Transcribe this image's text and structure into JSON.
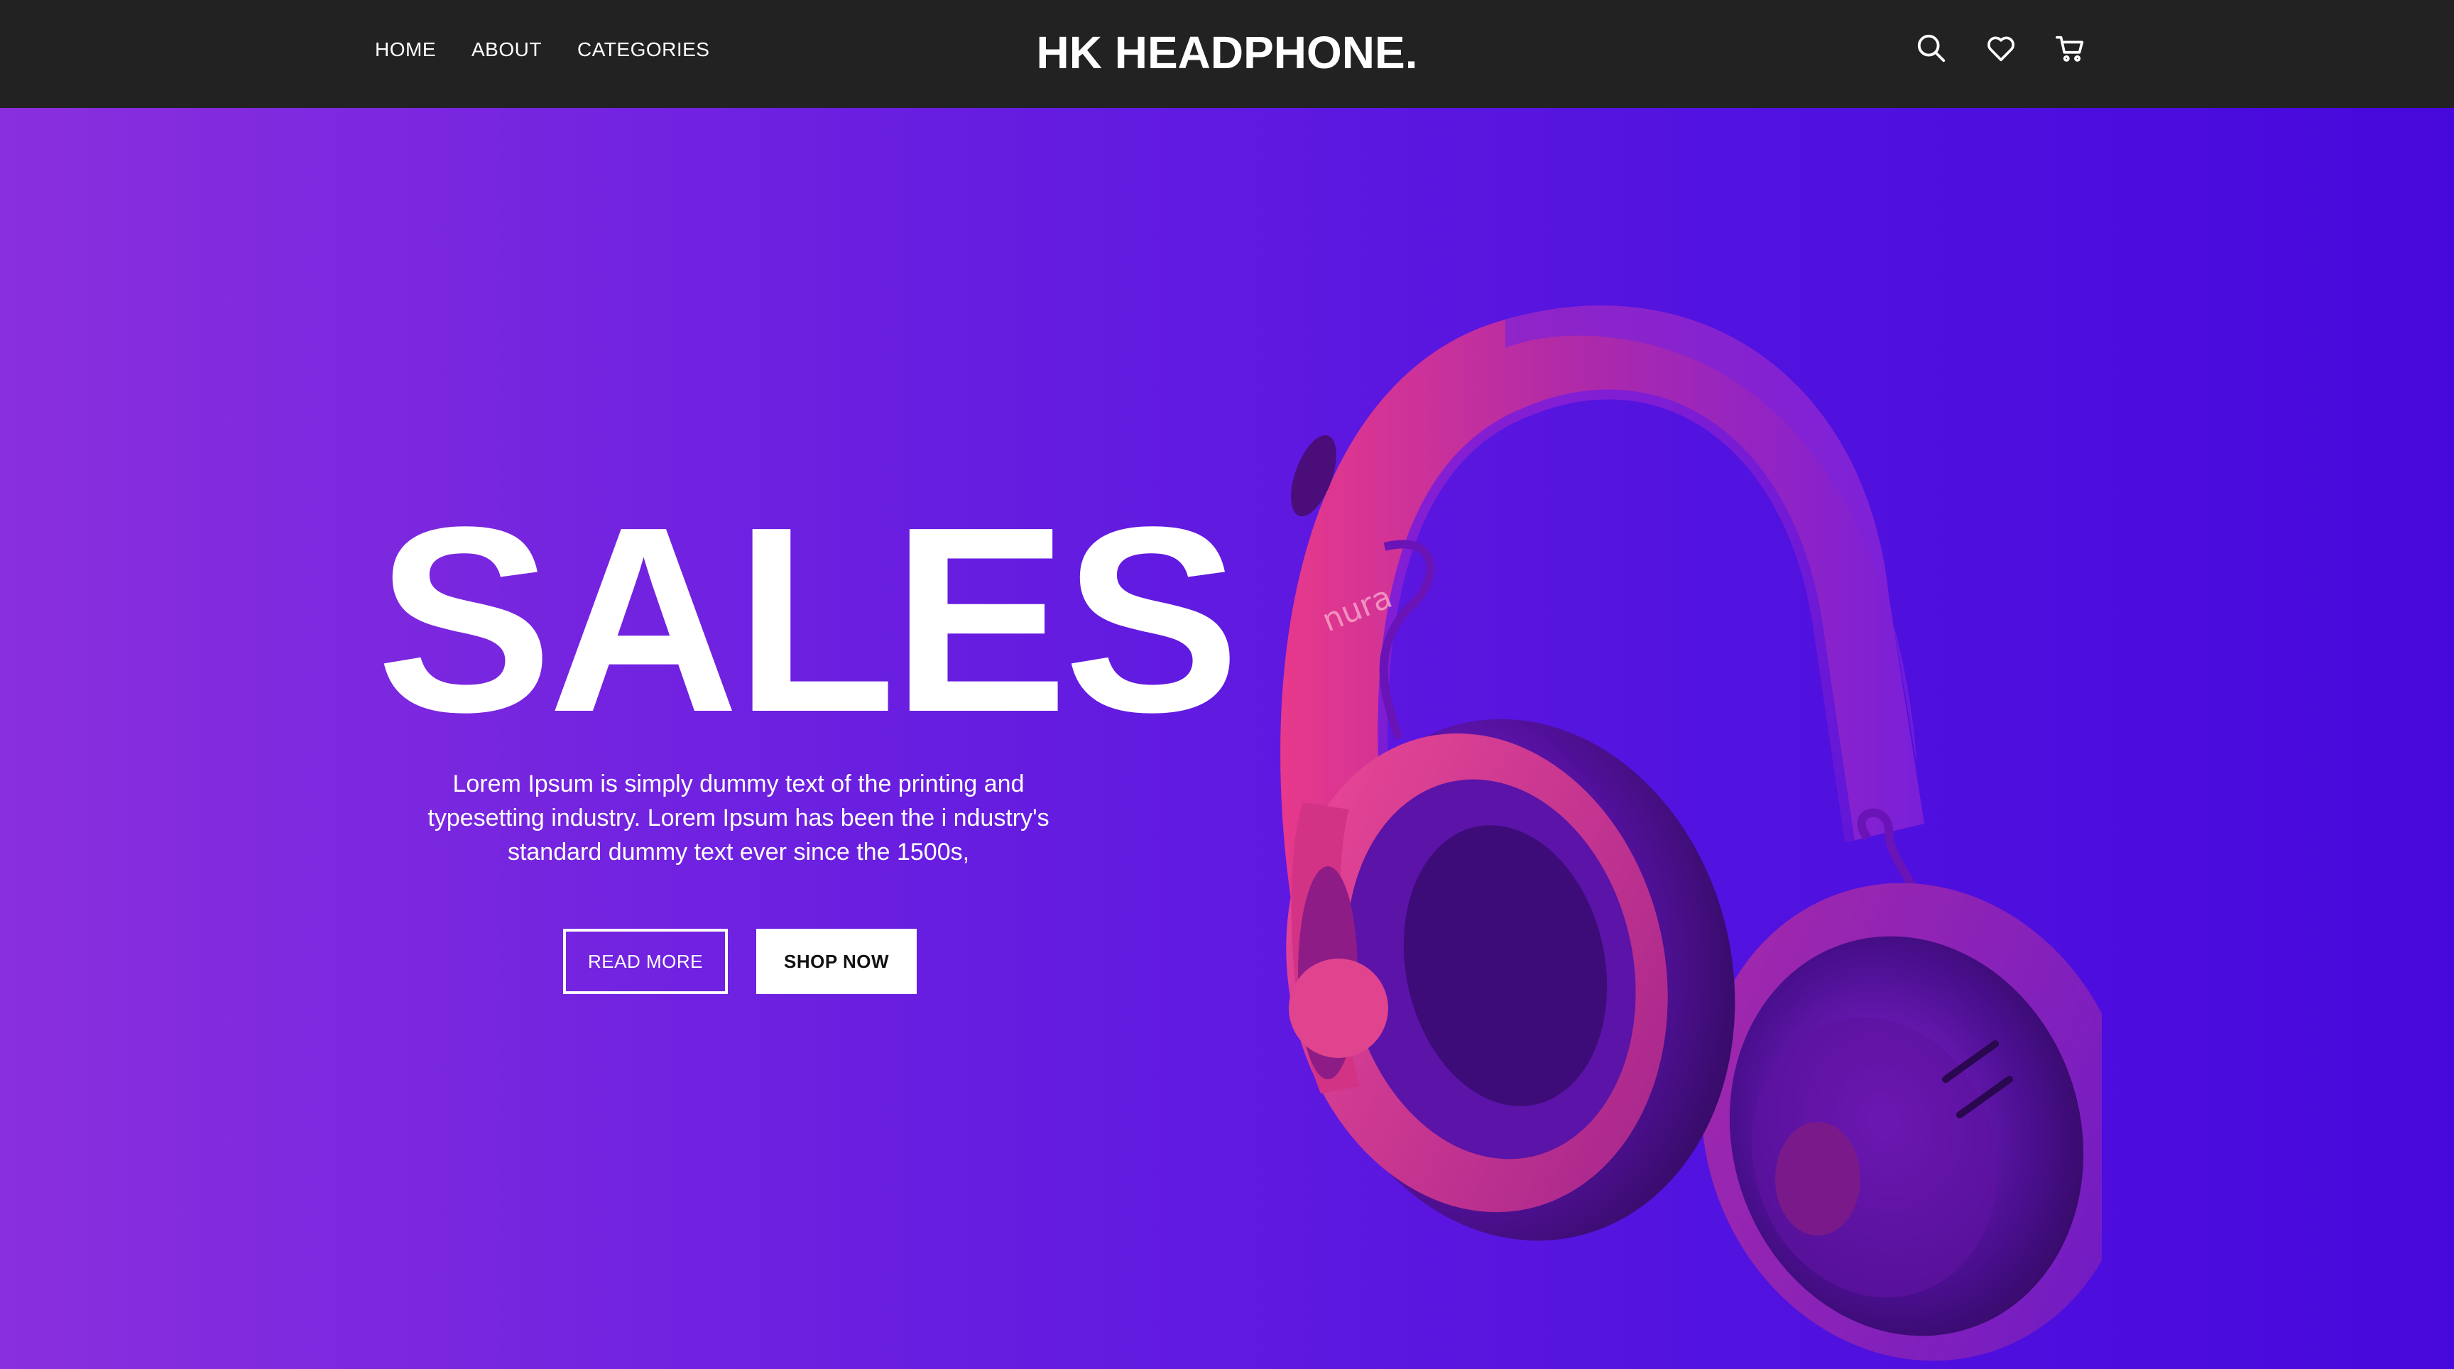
{
  "nav": {
    "links": [
      "HOME",
      "ABOUT",
      "CATEGORIES"
    ],
    "brand": "HK HEADPHONE.",
    "icons": [
      "search-icon",
      "heart-icon",
      "cart-icon"
    ]
  },
  "hero": {
    "title": "SALES",
    "description": "Lorem Ipsum is simply dummy text of the printing and typesetting industry. Lorem Ipsum has been the i ndustry's standard dummy text ever since the 1500s,",
    "buttons": {
      "read_more": "READ MORE",
      "shop_now": "SHOP NOW"
    },
    "product_brand": "nura"
  },
  "colors": {
    "navbar_bg": "#222222",
    "gradient_left": "#8a2fde",
    "gradient_right": "#4708dc",
    "headphone_pink": "#e03a88",
    "headphone_purple": "#6a1de8"
  }
}
